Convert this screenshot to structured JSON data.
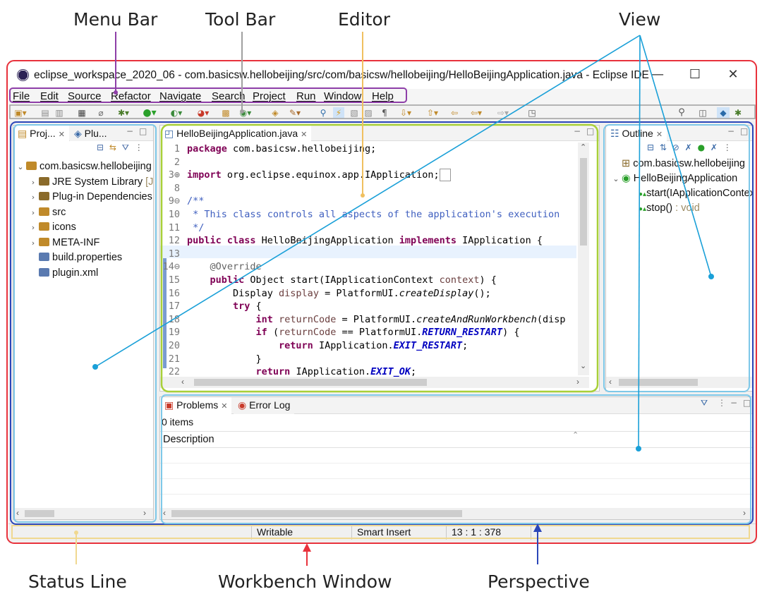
{
  "callouts": {
    "menu_bar": "Menu Bar",
    "tool_bar": "Tool Bar",
    "editor": "Editor",
    "view": "View",
    "status_line": "Status Line",
    "workbench_window": "Workbench Window",
    "perspective": "Perspective"
  },
  "window": {
    "title": "eclipse_workspace_2020_06 - com.basicsw.hellobeijing/src/com/basicsw/hellobeijing/HelloBeijingApplication.java - Eclipse IDE",
    "minimize": "—",
    "maximize": "☐",
    "close": "✕"
  },
  "menu": [
    "File",
    "Edit",
    "Source",
    "Refactor",
    "Navigate",
    "Search",
    "Project",
    "Run",
    "Window",
    "Help"
  ],
  "left_panel": {
    "tabs": [
      "Proj...",
      "Plu..."
    ],
    "tree": [
      {
        "label": "com.basicsw.hellobeijing",
        "suffix": "",
        "twisty": "⌄",
        "indent": 0
      },
      {
        "label": "JRE System Library",
        "suffix": " [Ja",
        "twisty": "›",
        "indent": 1
      },
      {
        "label": "Plug-in Dependencies",
        "suffix": "",
        "twisty": "›",
        "indent": 1
      },
      {
        "label": "src",
        "suffix": "",
        "twisty": "›",
        "indent": 1
      },
      {
        "label": "icons",
        "suffix": "",
        "twisty": "›",
        "indent": 1
      },
      {
        "label": "META-INF",
        "suffix": "",
        "twisty": "›",
        "indent": 1
      },
      {
        "label": "build.properties",
        "suffix": "",
        "twisty": "",
        "indent": 1
      },
      {
        "label": "plugin.xml",
        "suffix": "",
        "twisty": "",
        "indent": 1
      }
    ]
  },
  "editor": {
    "tab": "HelloBeijingApplication.java",
    "lines": [
      {
        "n": "1",
        "html": "<span class='kw'>package</span> com.basicsw.hellobeijing;"
      },
      {
        "n": "2",
        "html": ""
      },
      {
        "n": "3⊕",
        "html": "<span class='kw'>import</span> org.eclipse.equinox.app.IApplication;<span style='border:1px solid #999;padding:0 3px'>&nbsp;</span>"
      },
      {
        "n": "8",
        "html": ""
      },
      {
        "n": "9⊖",
        "html": "<span class='cm'>/**</span>"
      },
      {
        "n": "10",
        "html": "<span class='cm'> * This class controls all aspects of the application's execution</span>"
      },
      {
        "n": "11",
        "html": "<span class='cm'> */</span>"
      },
      {
        "n": "12",
        "html": "<span class='kw'>public class</span> HelloBeijingApplication <span class='kw'>implements</span> IApplication {"
      },
      {
        "n": "13",
        "html": ""
      },
      {
        "n": "14⊖",
        "html": "    <span class='an'>@Override</span>"
      },
      {
        "n": "15",
        "html": "    <span class='kw'>public</span> Object start(IApplicationContext <span class='var'>context</span>) {"
      },
      {
        "n": "16",
        "html": "        Display <span class='var'>display</span> = PlatformUI.<span class='ital'>createDisplay</span>();"
      },
      {
        "n": "17",
        "html": "        <span class='kw'>try</span> {"
      },
      {
        "n": "18",
        "html": "            <span class='kw'>int</span> <span class='var'>returnCode</span> = PlatformUI.<span class='ital'>createAndRunWorkbench</span>(disp"
      },
      {
        "n": "19",
        "html": "            <span class='kw'>if</span> (<span class='var'>returnCode</span> == PlatformUI.<span class='cst'>RETURN_RESTART</span>) {"
      },
      {
        "n": "20",
        "html": "                <span class='kw'>return</span> IApplication.<span class='cst'>EXIT_RESTART</span>;"
      },
      {
        "n": "21",
        "html": "            }"
      },
      {
        "n": "22",
        "html": "            <span class='kw'>return</span> IApplication.<span class='cst'>EXIT_OK</span>;"
      }
    ]
  },
  "outline": {
    "tab": "Outline",
    "items": [
      {
        "label": "com.basicsw.hellobeijing",
        "extra": ""
      },
      {
        "label": "HelloBeijingApplication",
        "extra": ""
      },
      {
        "label": "start(IApplicationContext)",
        "extra": ""
      },
      {
        "label": "stop()",
        "extra": " : void"
      }
    ]
  },
  "bottom": {
    "tabs": [
      "Problems",
      "Error Log"
    ],
    "items_count": "0 items",
    "column": "Description"
  },
  "status": {
    "writable": "Writable",
    "insert_mode": "Smart Insert",
    "position": "13 : 1 : 378"
  }
}
